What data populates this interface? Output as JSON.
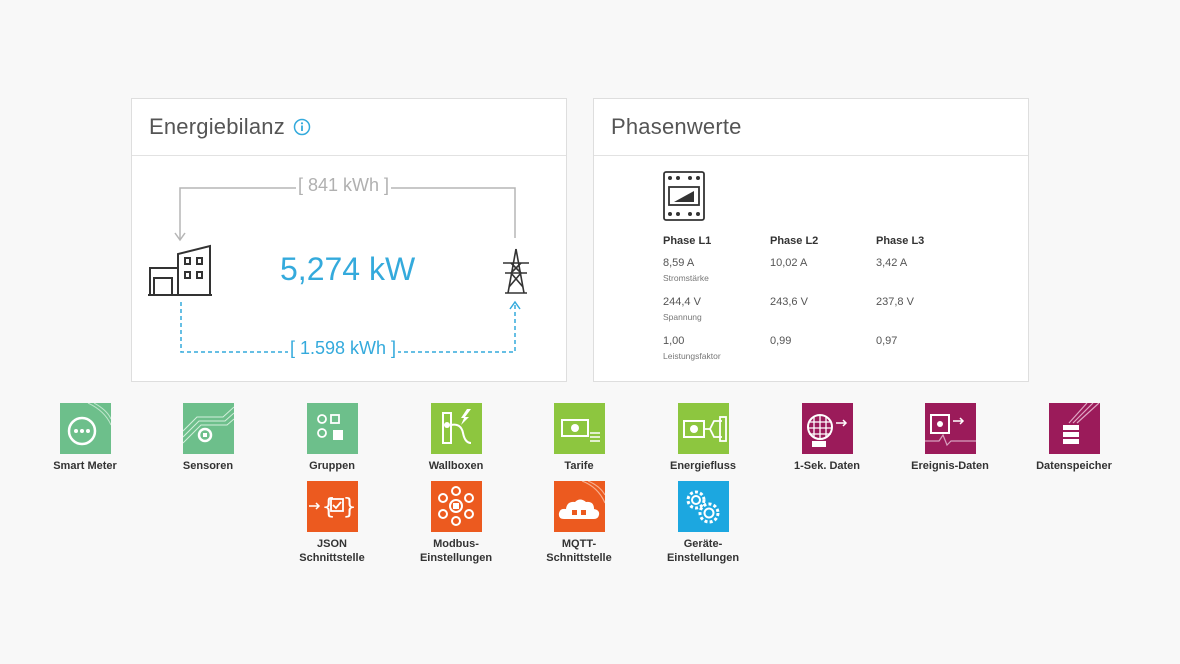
{
  "energy_card": {
    "title": "Energiebilanz",
    "flow_top": "[ 841 kWh ]",
    "flow_bottom": "[ 1.598 kWh ]",
    "power": "5,274 kW",
    "icons": {
      "building": "building-icon",
      "grid": "power-pylon-icon",
      "info": "info-icon"
    }
  },
  "phase_card": {
    "title": "Phasenwerte",
    "meter_icon": "meter-device-icon",
    "phases": [
      {
        "name": "Phase L1",
        "current": "8,59 A",
        "voltage": "244,4 V",
        "power_factor": "1,00"
      },
      {
        "name": "Phase L2",
        "current": "10,02 A",
        "voltage": "243,6 V",
        "power_factor": "0,99"
      },
      {
        "name": "Phase L3",
        "current": "3,42 A",
        "voltage": "237,8 V",
        "power_factor": "0,97"
      }
    ],
    "labels": {
      "current": "Stromstärke",
      "voltage": "Spannung",
      "power_factor": "Leistungsfaktor"
    }
  },
  "tiles": [
    {
      "label": "Smart Meter",
      "color": "#6dbf8b",
      "icon": "smart-meter-icon"
    },
    {
      "label": "Sensoren",
      "color": "#6dbf8b",
      "icon": "sensor-icon"
    },
    {
      "label": "Gruppen",
      "color": "#6dbf8b",
      "icon": "groups-icon"
    },
    {
      "label": "Wallboxen",
      "color": "#8dc63f",
      "icon": "wallbox-icon"
    },
    {
      "label": "Tarife",
      "color": "#8dc63f",
      "icon": "tariff-icon"
    },
    {
      "label": "Energiefluss",
      "color": "#8dc63f",
      "icon": "energy-flow-icon"
    },
    {
      "label": "1-Sek. Daten",
      "color": "#9b1b5a",
      "icon": "second-data-icon"
    },
    {
      "label": "Ereignis-Daten",
      "color": "#9b1b5a",
      "icon": "event-data-icon"
    },
    {
      "label": "Datenspeicher",
      "color": "#9b1b5a",
      "icon": "data-storage-icon"
    },
    {
      "label1": "JSON",
      "label2": "Schnittstelle",
      "color": "#ec5a1f",
      "icon": "json-interface-icon"
    },
    {
      "label1": "Modbus-",
      "label2": "Einstellungen",
      "color": "#ec5a1f",
      "icon": "modbus-settings-icon"
    },
    {
      "label1": "MQTT-",
      "label2": "Schnittstelle",
      "color": "#ec5a1f",
      "icon": "mqtt-cloud-icon"
    },
    {
      "label1": "Geräte-",
      "label2": "Einstellungen",
      "color": "#1ca7e0",
      "icon": "gears-icon"
    }
  ]
}
